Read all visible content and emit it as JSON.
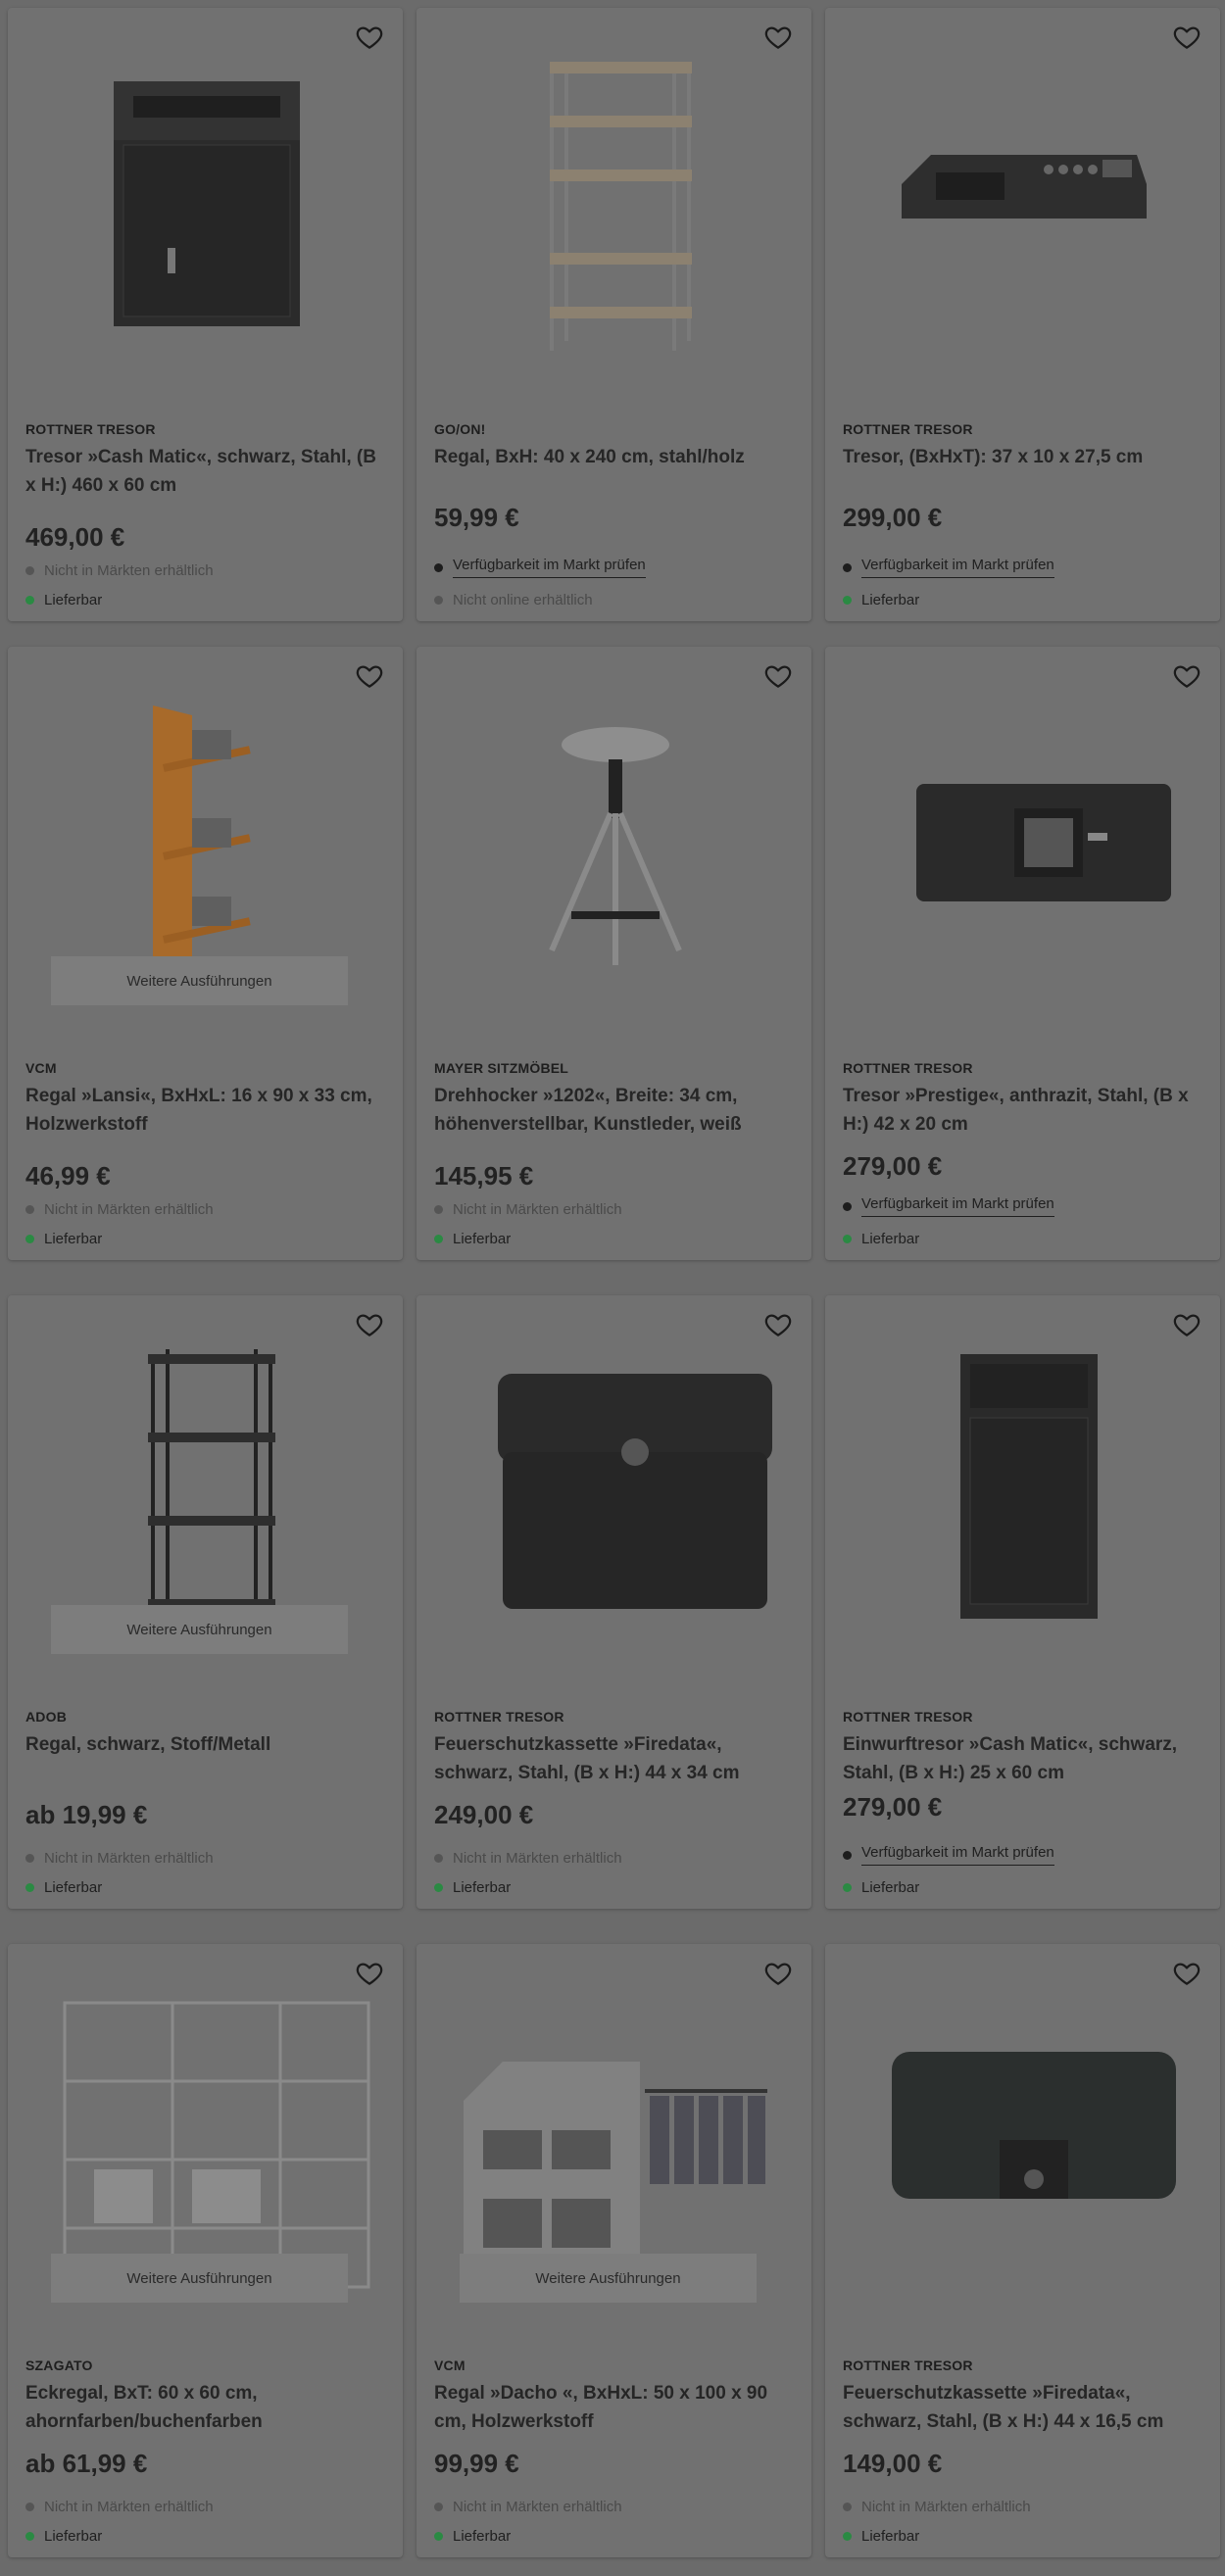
{
  "products": [
    {
      "brand": "ROTTNER TRESOR",
      "title": "Tresor »Cash Matic«, schwarz, Stahl, (B x H:) 460 x 60 cm",
      "price": "469,00 €",
      "store_status": "Nicht in Märkten erhältlich",
      "online_status": "Lieferbar",
      "image": "black-safe-with-slot",
      "variants": ""
    },
    {
      "brand": "GO/ON!",
      "title": "Regal, BxH: 40 x 240 cm, stahl/holz",
      "price": "59,99 €",
      "store_status": "Verfügbarkeit im Markt prüfen",
      "online_status": "Nicht online erhältlich",
      "image": "steel-wood-shelf",
      "variants": ""
    },
    {
      "brand": "ROTTNER TRESOR",
      "title": "Tresor, (BxHxT): 37 x 10 x 27,5 cm",
      "price": "299,00 €",
      "store_status": "Verfügbarkeit im Markt prüfen",
      "online_status": "Lieferbar",
      "image": "flat-keypad-safe",
      "variants": ""
    },
    {
      "brand": "VCM",
      "title": "Regal »Lansi«, BxHxL: 16 x 90 x 33 cm, Holzwerkstoff",
      "price": "46,99 €",
      "store_status": "Nicht in Märkten erhältlich",
      "online_status": "Lieferbar",
      "image": "cd-rack",
      "variants": "Weitere Ausführungen"
    },
    {
      "brand": "MAYER SITZMÖBEL",
      "title": "Drehhocker »1202«, Breite: 34 cm, höhenverstellbar, Kunstleder, weiß",
      "price": "145,95 €",
      "store_status": "Nicht in Märkten erhältlich",
      "online_status": "Lieferbar",
      "image": "white-stool",
      "variants": ""
    },
    {
      "brand": "ROTTNER TRESOR",
      "title": "Tresor »Prestige«, anthrazit, Stahl, (B x H:) 42 x 20 cm",
      "price": "279,00 €",
      "store_status": "Verfügbarkeit im Markt prüfen",
      "online_status": "Lieferbar",
      "image": "prestige-safe",
      "variants": ""
    },
    {
      "brand": "ADOB",
      "title": "Regal, schwarz, Stoff/Metall",
      "price": "ab 19,99 €",
      "store_status": "Nicht in Märkten erhältlich",
      "online_status": "Lieferbar",
      "image": "black-metal-shelf",
      "variants": "Weitere Ausführungen"
    },
    {
      "brand": "ROTTNER TRESOR",
      "title": "Feuerschutzkassette »Firedata«, schwarz, Stahl, (B x H:) 44 x 34 cm",
      "price": "249,00 €",
      "store_status": "Nicht in Märkten erhältlich",
      "online_status": "Lieferbar",
      "image": "fire-chest-large",
      "variants": ""
    },
    {
      "brand": "ROTTNER TRESOR",
      "title": "Einwurftresor »Cash Matic«, schwarz, Stahl, (B x H:) 25 x 60 cm",
      "price": "279,00 €",
      "store_status": "Verfügbarkeit im Markt prüfen",
      "online_status": "Lieferbar",
      "image": "tall-deposit-safe",
      "variants": ""
    },
    {
      "brand": "SZAGATO",
      "title": "Eckregal, BxT: 60 x 60 cm, ahornfarben/buchenfarben",
      "price": "ab 61,99 €",
      "store_status": "Nicht in Märkten erhältlich",
      "online_status": "Lieferbar",
      "image": "corner-shelf",
      "variants": "Weitere Ausführungen"
    },
    {
      "brand": "VCM",
      "title": "Regal »Dacho «, BxHxL: 50 x 100 x 90 cm, Holzwerkstoff",
      "price": "99,99 €",
      "store_status": "Nicht in Märkten erhältlich",
      "online_status": "Lieferbar",
      "image": "closet-organizer",
      "variants": "Weitere Ausführungen"
    },
    {
      "brand": "ROTTNER TRESOR",
      "title": "Feuerschutzkassette »Firedata«, schwarz, Stahl, (B x H:) 44 x 16,5 cm",
      "price": "149,00 €",
      "store_status": "Nicht in Märkten erhältlich",
      "online_status": "Lieferbar",
      "image": "fire-chest-small",
      "variants": ""
    }
  ],
  "colors": {
    "background": "#6b6b6b",
    "card": "#717171",
    "available_dot": "#2a8a43",
    "unavailable_dot": "#555555"
  },
  "icons": {
    "wishlist": "heart-outline-icon"
  }
}
